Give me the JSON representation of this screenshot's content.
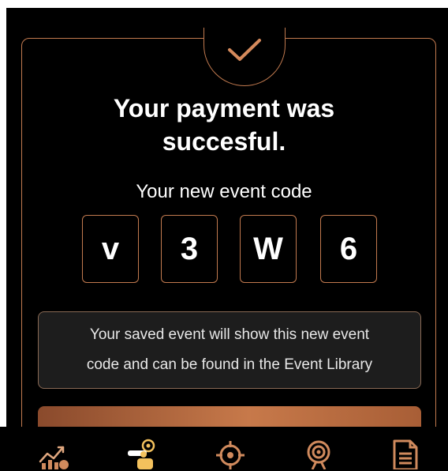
{
  "payment": {
    "title_line1": "Your payment was",
    "title_line2": "succesful.",
    "subtitle": "Your new event code"
  },
  "event_code": [
    "v",
    "3",
    "W",
    "6"
  ],
  "info": {
    "line1": "Your saved event will show this new event",
    "line2": "code and can be found in the Event Library"
  },
  "icons": {
    "success": "check-icon",
    "nav": [
      "analytics-icon",
      "explorer-icon",
      "crosshair-icon",
      "target-icon",
      "document-icon"
    ]
  },
  "colors": {
    "background": "#000000",
    "accent": "#c27a4f",
    "accent_light": "#e0a77f",
    "text": "#ffffff",
    "info_bg": "#1d1d1d"
  }
}
